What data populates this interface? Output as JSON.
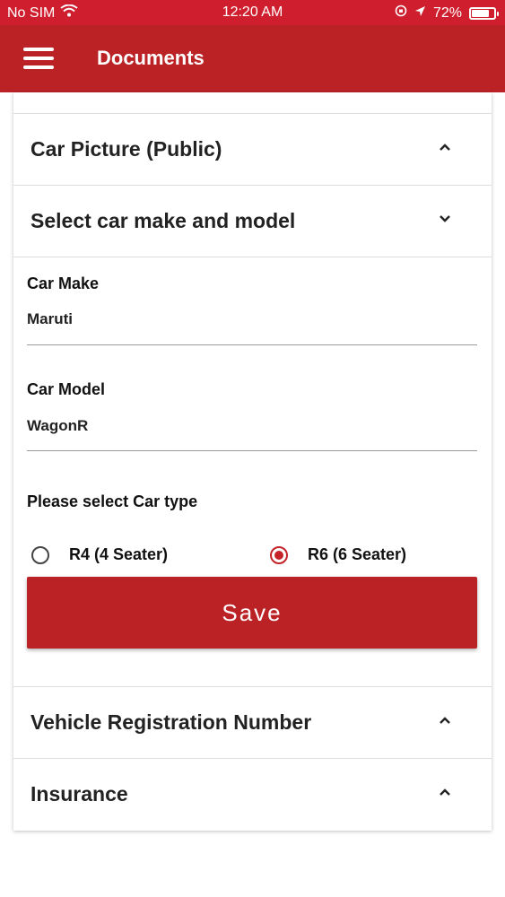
{
  "status_bar": {
    "carrier": "No SIM",
    "time": "12:20 AM",
    "battery": "72%",
    "battery_level": 0.72
  },
  "app_bar": {
    "title": "Documents"
  },
  "sections": {
    "car_picture": "Car Picture (Public)",
    "car_make_model": "Select car make and model",
    "vehicle_registration": "Vehicle Registration Number",
    "insurance": "Insurance"
  },
  "form": {
    "car_make_label": "Car Make",
    "car_make_value": "Maruti",
    "car_model_label": "Car Model",
    "car_model_value": "WagonR",
    "car_type_prompt": "Please select Car type",
    "options": [
      {
        "label": "R4 (4 Seater)",
        "selected": false
      },
      {
        "label": "R6 (6 Seater)",
        "selected": true
      }
    ],
    "save_label": "Save"
  },
  "colors": {
    "status_bar": "#cf1f2e",
    "app_bar": "#bb2226",
    "accent": "#c4232a"
  },
  "icons": {
    "menu": "hamburger-icon",
    "expand": "chevron-down-icon",
    "collapse": "chevron-up-icon"
  }
}
